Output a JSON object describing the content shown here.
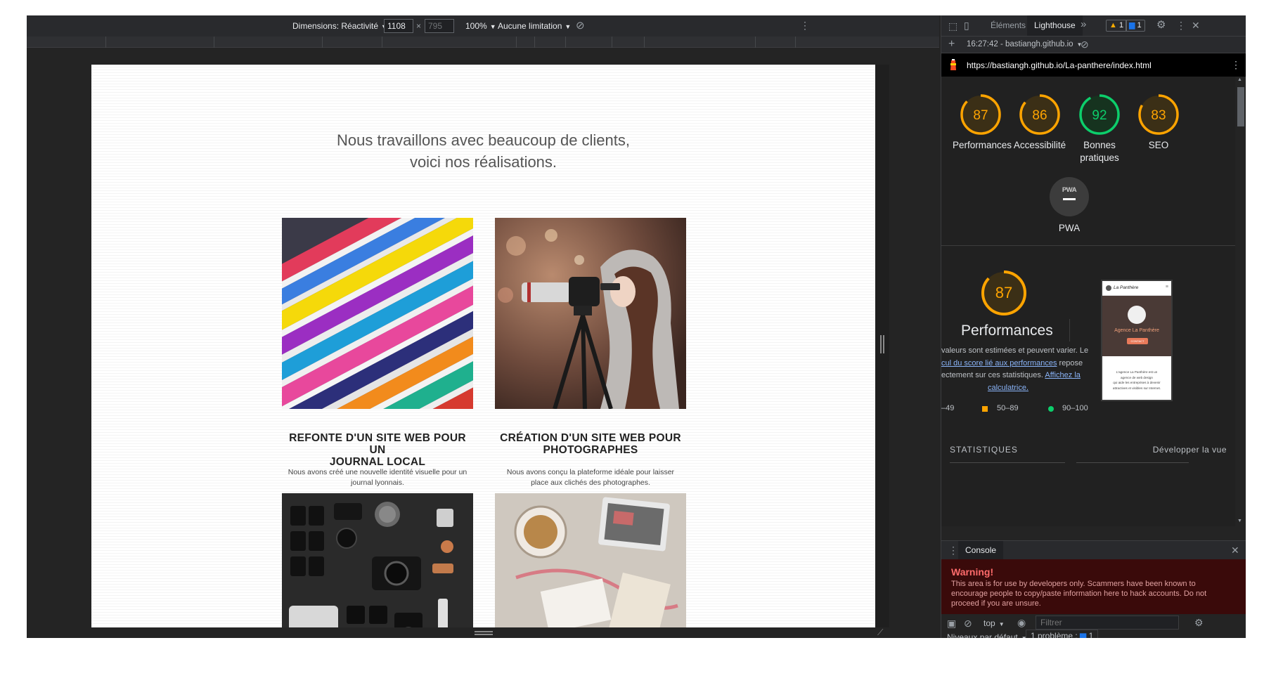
{
  "device_toolbar": {
    "dimensions_label": "Dimensions: Réactivité",
    "width_value": "1108",
    "times": "×",
    "height_value": "795",
    "zoom": "100%",
    "throttle": "Aucune limitation"
  },
  "website": {
    "heading_line1": "Nous travaillons avec beaucoup de clients,",
    "heading_line2": "voici nos réalisations.",
    "cards": [
      {
        "title_line1": "REFONTE D'UN SITE WEB POUR UN",
        "title_line2": "JOURNAL LOCAL",
        "desc_line1": "Nous avons créé une nouvelle identité visuelle pour un",
        "desc_line2": "journal lyonnais."
      },
      {
        "title_line1": "CRÉATION D'UN SITE WEB POUR",
        "title_line2": "PHOTOGRAPHES",
        "desc_line1": "Nous avons conçu la plateforme idéale pour laisser",
        "desc_line2": "place aux clichés des photographes."
      }
    ]
  },
  "devtools": {
    "tabs": [
      "Éléments",
      "Lighthouse"
    ],
    "more": "»",
    "warning_count": "1",
    "issue_count": "1",
    "report_selector": "16:27:42 - bastiangh.github.io",
    "url": "https://bastiangh.github.io/La-panthere/index.html",
    "scores": [
      {
        "value": 87,
        "label_line1": "Performances",
        "label_line2": "",
        "status": "average"
      },
      {
        "value": 86,
        "label_line1": "Accessibilité",
        "label_line2": "",
        "status": "average"
      },
      {
        "value": 92,
        "label_line1": "Bonnes",
        "label_line2": "pratiques",
        "status": "pass"
      },
      {
        "value": 83,
        "label_line1": "SEO",
        "label_line2": "",
        "status": "average"
      }
    ],
    "pwa": {
      "badge": "PWA",
      "label": "PWA"
    },
    "perf": {
      "score": 87,
      "title": "Performances",
      "line1": "valeurs sont estimées et peuvent varier. Le",
      "line2_link": "cul du score lié aux performances",
      "line2_rest": "repose",
      "line3_text": "ectement sur ces statistiques.",
      "line3_link": "Affichez la",
      "line4_link": "calculatrice.",
      "legend": [
        "–49",
        "50–89",
        "90–100"
      ]
    },
    "thumbnail": {
      "brand": "La Panthère",
      "hero_title": "Agence La Panthère",
      "cta": "CONTACT",
      "text_line1": "L'agence La Panthère est un",
      "text_line2": "agence de web design",
      "text_line3": "qui aide les entreprises à devenir",
      "text_line4": "attractives et visibles sur Internet."
    },
    "stats_title": "STATISTIQUES",
    "expand_view": "Développer la vue",
    "console": {
      "tab": "Console",
      "warning_title": "Warning!",
      "warning_line1": "This area is for use by developers only. Scammers have been known to",
      "warning_line2": "encourage people to copy/paste information here to hack accounts. Do not",
      "warning_line3": "proceed if you are unsure.",
      "context": "top",
      "filter_placeholder": "Filtrer",
      "levels": "Niveaux par défaut",
      "problems": "1 problème :",
      "problems_count": "1"
    }
  },
  "colors": {
    "average": "#ffa400",
    "pass": "#0cce6b",
    "fail": "#ff4e42",
    "link": "#8ab4f8"
  }
}
